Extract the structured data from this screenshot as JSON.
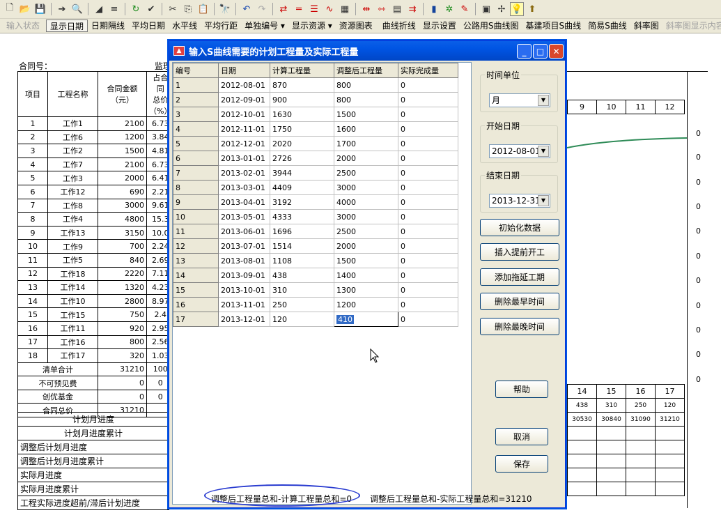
{
  "toolbar2": {
    "items": [
      {
        "label": "输入状态",
        "disabled": true
      },
      {
        "label": "显示日期",
        "pressed": true
      },
      {
        "label": "日期隔线"
      },
      {
        "label": "平均日期"
      },
      {
        "label": "水平线"
      },
      {
        "label": "平均行距"
      },
      {
        "label": "单独编号 ▾"
      },
      {
        "label": "显示资源 ▾"
      },
      {
        "label": "资源图表"
      },
      {
        "label": "曲线折线"
      },
      {
        "label": "显示设置"
      },
      {
        "label": "公路用S曲线图"
      },
      {
        "label": "基建项目S曲线"
      },
      {
        "label": "简易S曲线"
      },
      {
        "label": "斜率图"
      },
      {
        "label": "斜率图显示内容",
        "disabled": true
      }
    ]
  },
  "background": {
    "contract_label": "合同号：",
    "monitor_label": "监理",
    "headers": [
      "项目",
      "工程名称",
      "合同金额\n（元）",
      "占合同\n总价\n（%）"
    ],
    "rows": [
      [
        "1",
        "工作1",
        "2100",
        "6.73"
      ],
      [
        "2",
        "工作6",
        "1200",
        "3.84"
      ],
      [
        "3",
        "工作2",
        "1500",
        "4.81"
      ],
      [
        "4",
        "工作7",
        "2100",
        "6.73"
      ],
      [
        "5",
        "工作3",
        "2000",
        "6.41"
      ],
      [
        "6",
        "工作12",
        "690",
        "2.21"
      ],
      [
        "7",
        "工作8",
        "3000",
        "9.61"
      ],
      [
        "8",
        "工作4",
        "4800",
        "15.3"
      ],
      [
        "9",
        "工作13",
        "3150",
        "10.0"
      ],
      [
        "10",
        "工作9",
        "700",
        "2.24"
      ],
      [
        "11",
        "工作5",
        "840",
        "2.69"
      ],
      [
        "12",
        "工作18",
        "2220",
        "7.11"
      ],
      [
        "13",
        "工作14",
        "1320",
        "4.23"
      ],
      [
        "14",
        "工作10",
        "2800",
        "8.97"
      ],
      [
        "15",
        "工作15",
        "750",
        "2.4"
      ],
      [
        "16",
        "工作11",
        "920",
        "2.95"
      ],
      [
        "17",
        "工作16",
        "800",
        "2.56"
      ],
      [
        "18",
        "工作17",
        "320",
        "1.03"
      ]
    ],
    "summary_rows": [
      [
        "清单合计",
        "31210",
        "100"
      ],
      [
        "不可预见费",
        "0",
        "0"
      ],
      [
        "创优基金",
        "0",
        "0"
      ],
      [
        "合同总价",
        "31210",
        ""
      ]
    ],
    "bottom_rows": [
      "计划月进度",
      "计划月进度累计",
      "调整后计划月进度",
      "调整后计划月进度累计",
      "实际月进度",
      "实际月进度累计",
      "工程实际进度超前/滞后计划进度"
    ],
    "month_headers_top": [
      "9",
      "10",
      "11",
      "12"
    ],
    "month_headers_bottom": [
      "14",
      "15",
      "16",
      "17"
    ],
    "plan_monthly": [
      "438",
      "310",
      "250",
      "120"
    ],
    "plan_cumulative": [
      "30530",
      "30840",
      "31090",
      "31210"
    ],
    "zeros": [
      "0",
      "0",
      "0",
      "0",
      "0",
      "0",
      "0",
      "0",
      "0",
      "0"
    ]
  },
  "dialog": {
    "title": "输入S曲线需要的计划工程量及实际工程量",
    "columns": [
      "编号",
      "日期",
      "计算工程量",
      "调整后工程量",
      "实际完成量"
    ],
    "rows": [
      [
        "1",
        "2012-08-01",
        "870",
        "800",
        "0"
      ],
      [
        "2",
        "2012-09-01",
        "900",
        "800",
        "0"
      ],
      [
        "3",
        "2012-10-01",
        "1630",
        "1500",
        "0"
      ],
      [
        "4",
        "2012-11-01",
        "1750",
        "1600",
        "0"
      ],
      [
        "5",
        "2012-12-01",
        "2020",
        "1700",
        "0"
      ],
      [
        "6",
        "2013-01-01",
        "2726",
        "2000",
        "0"
      ],
      [
        "7",
        "2013-02-01",
        "3944",
        "2500",
        "0"
      ],
      [
        "8",
        "2013-03-01",
        "4409",
        "3000",
        "0"
      ],
      [
        "9",
        "2013-04-01",
        "3192",
        "4000",
        "0"
      ],
      [
        "10",
        "2013-05-01",
        "4333",
        "3000",
        "0"
      ],
      [
        "11",
        "2013-06-01",
        "1696",
        "2500",
        "0"
      ],
      [
        "12",
        "2013-07-01",
        "1514",
        "2000",
        "0"
      ],
      [
        "13",
        "2013-08-01",
        "1108",
        "1500",
        "0"
      ],
      [
        "14",
        "2013-09-01",
        "438",
        "1400",
        "0"
      ],
      [
        "15",
        "2013-10-01",
        "310",
        "1300",
        "0"
      ],
      [
        "16",
        "2013-11-01",
        "250",
        "1200",
        "0"
      ],
      [
        "17",
        "2013-12-01",
        "120",
        "410",
        "0"
      ]
    ],
    "time_unit_label": "时间单位",
    "time_unit_value": "月",
    "start_label": "开始日期",
    "start_value": "2012-08-01",
    "end_label": "结束日期",
    "end_value": "2013-12-31",
    "btn_init": "初始化数据",
    "btn_insert": "插入提前开工",
    "btn_add": "添加拖延工期",
    "btn_del_early": "删除最早时间",
    "btn_del_late": "删除最晚时间",
    "btn_help": "帮助",
    "btn_cancel": "取消",
    "btn_save": "保存",
    "status_left": "调整后工程量总和-计算工程量总和=0",
    "status_right": "调整后工程量总和-实际工程量总和=31210"
  },
  "colors": {
    "titlebar": "#0054e3",
    "curve": "#2e8b57",
    "annotation": "#2a3cd0",
    "selection": "#316ac5"
  }
}
